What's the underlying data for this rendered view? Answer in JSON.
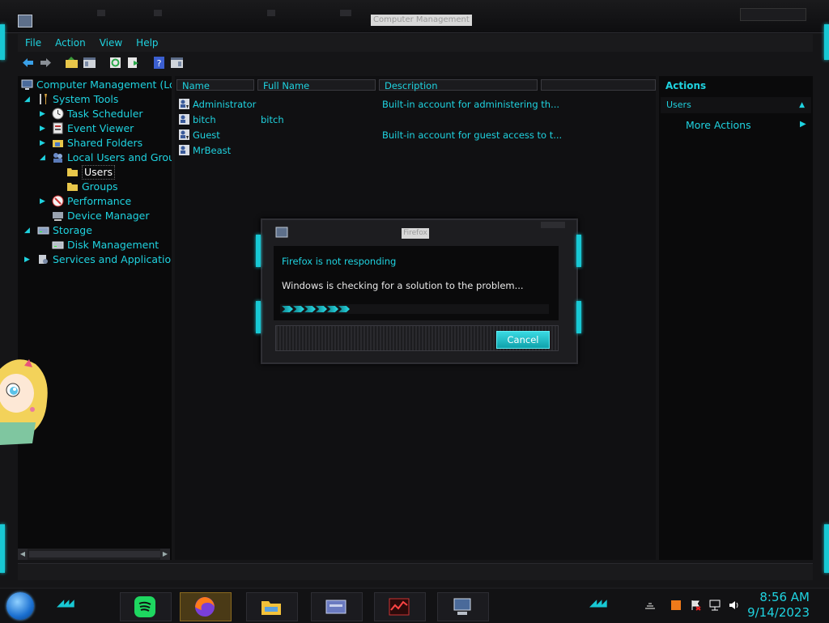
{
  "window": {
    "title": "Computer Management",
    "menu": [
      "File",
      "Action",
      "View",
      "Help"
    ]
  },
  "tree": {
    "items": [
      {
        "label": "Computer Management (Loc",
        "icon": "computer-icon"
      },
      {
        "label": "System Tools",
        "icon": "tools-icon"
      },
      {
        "label": "Task Scheduler",
        "icon": "clock-icon"
      },
      {
        "label": "Event Viewer",
        "icon": "event-viewer-icon"
      },
      {
        "label": "Shared Folders",
        "icon": "shared-folder-icon"
      },
      {
        "label": "Local Users and Grou",
        "icon": "users-icon"
      },
      {
        "label": "Users",
        "icon": "folder-icon"
      },
      {
        "label": "Groups",
        "icon": "folder-icon"
      },
      {
        "label": "Performance",
        "icon": "performance-icon"
      },
      {
        "label": "Device Manager",
        "icon": "device-manager-icon"
      },
      {
        "label": "Storage",
        "icon": "storage-icon"
      },
      {
        "label": "Disk Management",
        "icon": "disk-icon"
      },
      {
        "label": "Services and Applications",
        "icon": "services-icon"
      }
    ]
  },
  "list": {
    "columns": [
      "Name",
      "Full Name",
      "Description",
      ""
    ],
    "rows": [
      {
        "name": "Administrator",
        "full_name": "",
        "description": "Built-in account for administering th..."
      },
      {
        "name": "bitch",
        "full_name": "bitch",
        "description": ""
      },
      {
        "name": "Guest",
        "full_name": "",
        "description": "Built-in account for guest access to t..."
      },
      {
        "name": "MrBeast",
        "full_name": "",
        "description": ""
      }
    ]
  },
  "actions": {
    "title": "Actions",
    "section": "Users",
    "more": "More Actions"
  },
  "dialog": {
    "title": "Firefox",
    "heading": "Firefox is not responding",
    "message": "Windows is checking for a solution to the problem...",
    "cancel": "Cancel"
  },
  "taskbar": {
    "apps": [
      "spotify-icon",
      "firefox-icon",
      "file-explorer-icon",
      "control-panel-icon",
      "task-manager-icon",
      "computer-management-icon"
    ],
    "time": "8:56 AM",
    "date": "9/14/2023"
  },
  "colors": {
    "accent": "#1fd3e0",
    "background": "#151517",
    "panel": "#0a0a0b"
  }
}
